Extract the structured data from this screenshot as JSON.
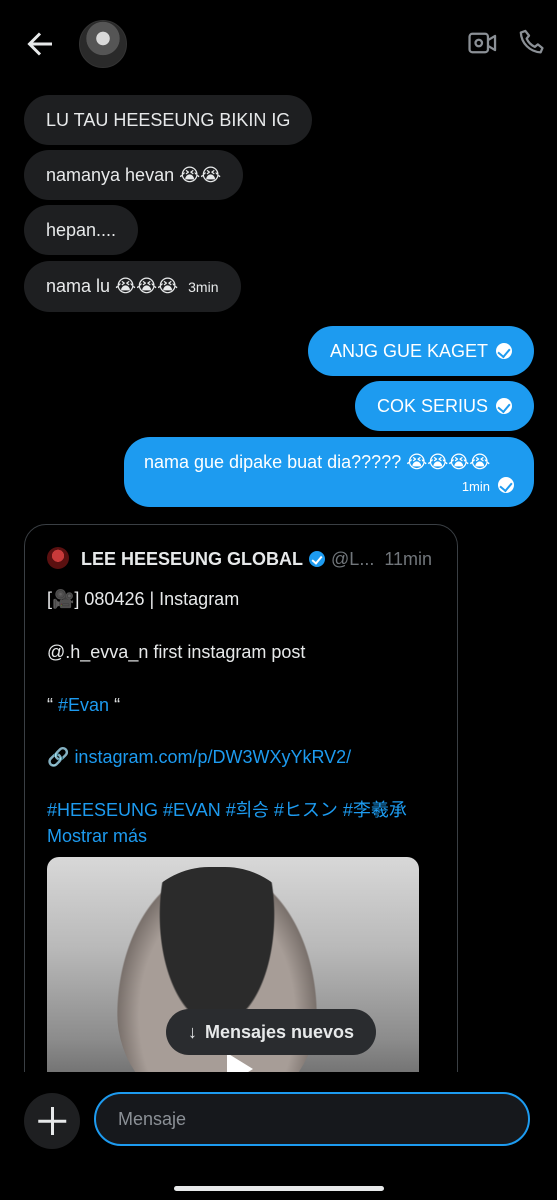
{
  "header": {
    "back": "back-arrow-icon",
    "avatar": "avatar",
    "video_icon": "video-call-icon",
    "phone_icon": "phone-icon"
  },
  "messages": [
    {
      "side": "in",
      "text": "LU TAU HEESEUNG BIKIN IG"
    },
    {
      "side": "in",
      "text": "namanya hevan 😭😭"
    },
    {
      "side": "in",
      "text": "hepan...."
    },
    {
      "side": "in",
      "text": "nama lu 😭😭😭",
      "time": "3min"
    },
    {
      "side": "out",
      "text": "ANJG GUE KAGET"
    },
    {
      "side": "out",
      "text": "COK SERIUS"
    },
    {
      "side": "out",
      "text": "nama gue dipake buat dia????? 😭😭😭😭",
      "time": "1min"
    }
  ],
  "tweet": {
    "author": "LEE HEESEUNG GLOBAL",
    "handle": "@L...",
    "time": "11min",
    "line1": "[🎥] 080426 | Instagram",
    "line2": "@.h_evva_n first instagram post",
    "quote_open": "“",
    "hashtag_evan": "#Evan",
    "quote_close": "“",
    "link_icon": "🔗",
    "link": "instagram.com/p/DW3WXyYkRV2/",
    "hashtags": "#HEESEUNG #EVAN #희승 #ヒスン #李羲承",
    "more": "Mostrar más"
  },
  "toast": {
    "arrow": "↓",
    "label": "Mensajes nuevos"
  },
  "composer": {
    "placeholder": "Mensaje"
  },
  "colors": {
    "accent": "#1d9bf0",
    "incoming": "#1e1f21",
    "background": "#000000"
  }
}
